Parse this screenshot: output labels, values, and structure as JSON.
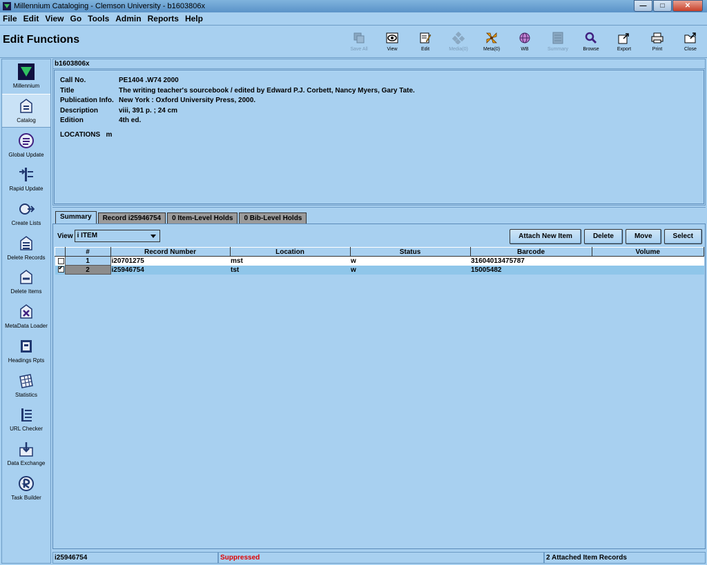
{
  "window": {
    "title": "Millennium Cataloging - Clemson University - b1603806x"
  },
  "menu": [
    "File",
    "Edit",
    "View",
    "Go",
    "Tools",
    "Admin",
    "Reports",
    "Help"
  ],
  "header": {
    "title": "Edit Functions"
  },
  "toolbar": [
    {
      "label": "Save All",
      "icon": "save-all-icon",
      "enabled": false
    },
    {
      "label": "View",
      "icon": "view-icon",
      "enabled": true
    },
    {
      "label": "Edit",
      "icon": "edit-icon",
      "enabled": true
    },
    {
      "label": "Media(0)",
      "icon": "media-icon",
      "enabled": false
    },
    {
      "label": "Meta(0)",
      "icon": "meta-icon",
      "enabled": true
    },
    {
      "label": "WB",
      "icon": "web-globe-icon",
      "enabled": true
    },
    {
      "label": "Summary",
      "icon": "summary-icon",
      "enabled": false
    },
    {
      "label": "Browse",
      "icon": "browse-magnifier-icon",
      "enabled": true
    },
    {
      "label": "Export",
      "icon": "export-icon",
      "enabled": true
    },
    {
      "label": "Print",
      "icon": "print-icon",
      "enabled": true
    },
    {
      "label": "Close",
      "icon": "close-folder-icon",
      "enabled": true
    }
  ],
  "sidebar": {
    "items": [
      {
        "label": "Millennium",
        "icon": "millennium-logo-icon"
      },
      {
        "label": "Catalog",
        "icon": "catalog-icon",
        "active": true
      },
      {
        "label": "Global Update",
        "icon": "global-update-icon"
      },
      {
        "label": "Rapid Update",
        "icon": "rapid-update-icon"
      },
      {
        "label": "Create Lists",
        "icon": "create-lists-icon"
      },
      {
        "label": "Delete Records",
        "icon": "delete-records-icon"
      },
      {
        "label": "Delete Items",
        "icon": "delete-items-icon"
      },
      {
        "label": "MetaData Loader",
        "icon": "metadata-loader-icon"
      },
      {
        "label": "Headings Rpts",
        "icon": "headings-reports-icon"
      },
      {
        "label": "Statistics",
        "icon": "statistics-icon"
      },
      {
        "label": "URL Checker",
        "icon": "url-checker-icon"
      },
      {
        "label": "Data Exchange",
        "icon": "data-exchange-icon"
      },
      {
        "label": "Task Builder",
        "icon": "task-builder-icon"
      }
    ]
  },
  "record": {
    "id": "b1603806x",
    "fields": [
      {
        "label": "Call No.",
        "value": "PE1404 .W74 2000"
      },
      {
        "label": "Title",
        "value": "The writing teacher's sourcebook / edited by Edward P.J. Corbett, Nancy Myers, Gary Tate."
      },
      {
        "label": "Publication Info.",
        "value": "New York : Oxford University Press, 2000."
      },
      {
        "label": "Description",
        "value": "viii, 391 p. ; 24 cm"
      },
      {
        "label": "Edition",
        "value": "4th ed."
      }
    ],
    "locations_label": "LOCATIONS",
    "locations_value": "m"
  },
  "tabs": [
    "Summary",
    "Record i25946754",
    "0 Item-Level Holds",
    "0 Bib-Level Holds"
  ],
  "view": {
    "label": "View",
    "selected": "i ITEM"
  },
  "actions": {
    "attach": "Attach New Item",
    "delete": "Delete",
    "move": "Move",
    "select": "Select"
  },
  "table": {
    "columns": [
      "#",
      "Record Number",
      "Location",
      "Status",
      "Barcode",
      "Volume"
    ],
    "rows": [
      {
        "num": "1",
        "record": "i20701275",
        "location": "mst",
        "status": "w",
        "barcode": "31604013475787",
        "volume": "",
        "checked": false
      },
      {
        "num": "2",
        "record": "i25946754",
        "location": "tst",
        "status": "w",
        "barcode": "15005482",
        "volume": "",
        "checked": true
      }
    ]
  },
  "status": {
    "record": "i25946754",
    "suppressed": "Suppressed",
    "attached": "2 Attached Item Records"
  }
}
